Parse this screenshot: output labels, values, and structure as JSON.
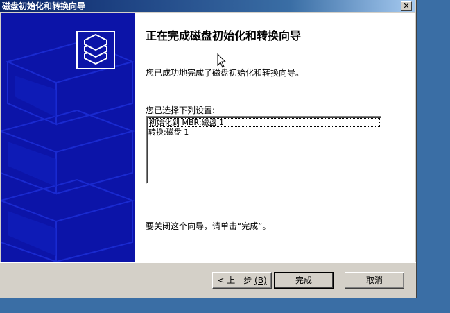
{
  "window": {
    "title": "磁盘初始化和转换向导",
    "close_glyph": "✕"
  },
  "wizard": {
    "heading": "正在完成磁盘初始化和转换向导",
    "intro_text": "您已成功地完成了磁盘初始化和转换向导。",
    "settings_label": "您已选择下列设置:",
    "settings": [
      "初始化到 MBR:磁盘 1",
      "转换:磁盘 1"
    ],
    "close_instruction": "要关闭这个向导，请单击“完成”。"
  },
  "buttons": {
    "back": "< 上一步",
    "back_accel": "(B)",
    "finish": "完成",
    "cancel": "取消"
  },
  "colors": {
    "titlebar": "#0a246a",
    "sidebar": "#0c14a8",
    "face": "#d4d0c8",
    "desktop": "#3a6ea5"
  },
  "icons": {
    "sidebar_icon": "disk-stack-icon",
    "cursor": "mouse-pointer-icon"
  }
}
